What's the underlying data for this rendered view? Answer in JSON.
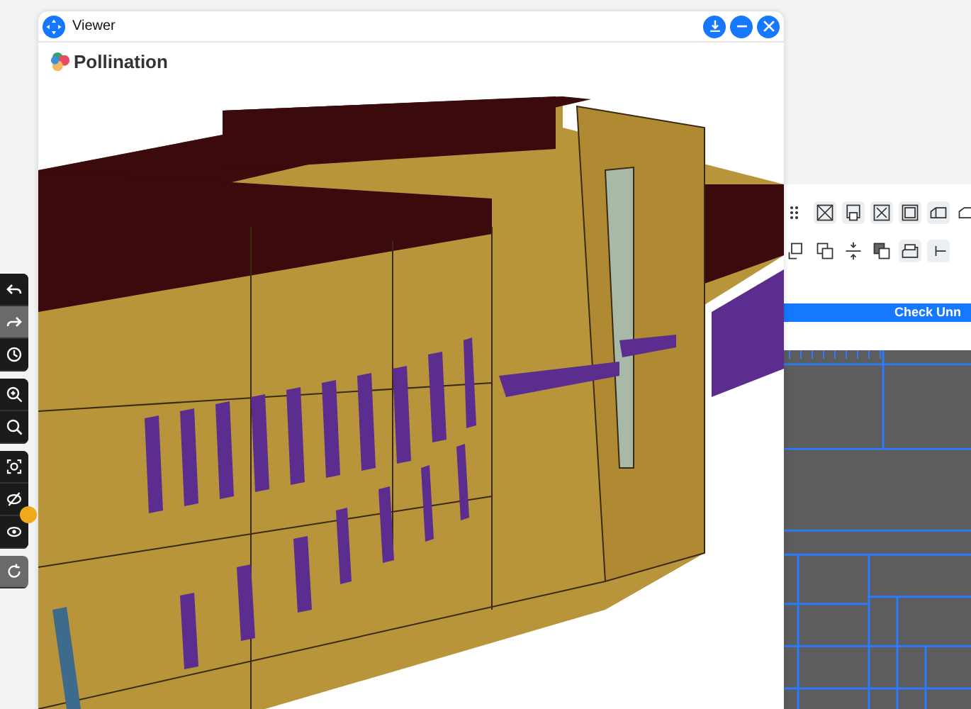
{
  "window": {
    "title": "Viewer",
    "logo_text": "Pollination"
  },
  "toolbar_groups": [
    [
      {
        "kind": "undo",
        "disabled": false
      },
      {
        "kind": "redo",
        "disabled": true
      },
      {
        "kind": "history",
        "disabled": false
      }
    ],
    [
      {
        "kind": "zoom-fit",
        "disabled": false
      },
      {
        "kind": "zoom",
        "disabled": false
      }
    ],
    [
      {
        "kind": "focus",
        "disabled": false
      },
      {
        "kind": "hide",
        "disabled": false
      },
      {
        "kind": "show",
        "disabled": false
      }
    ],
    [
      {
        "kind": "refresh",
        "disabled": true
      }
    ]
  ],
  "side_panel": {
    "check_button": "Check Unn"
  }
}
